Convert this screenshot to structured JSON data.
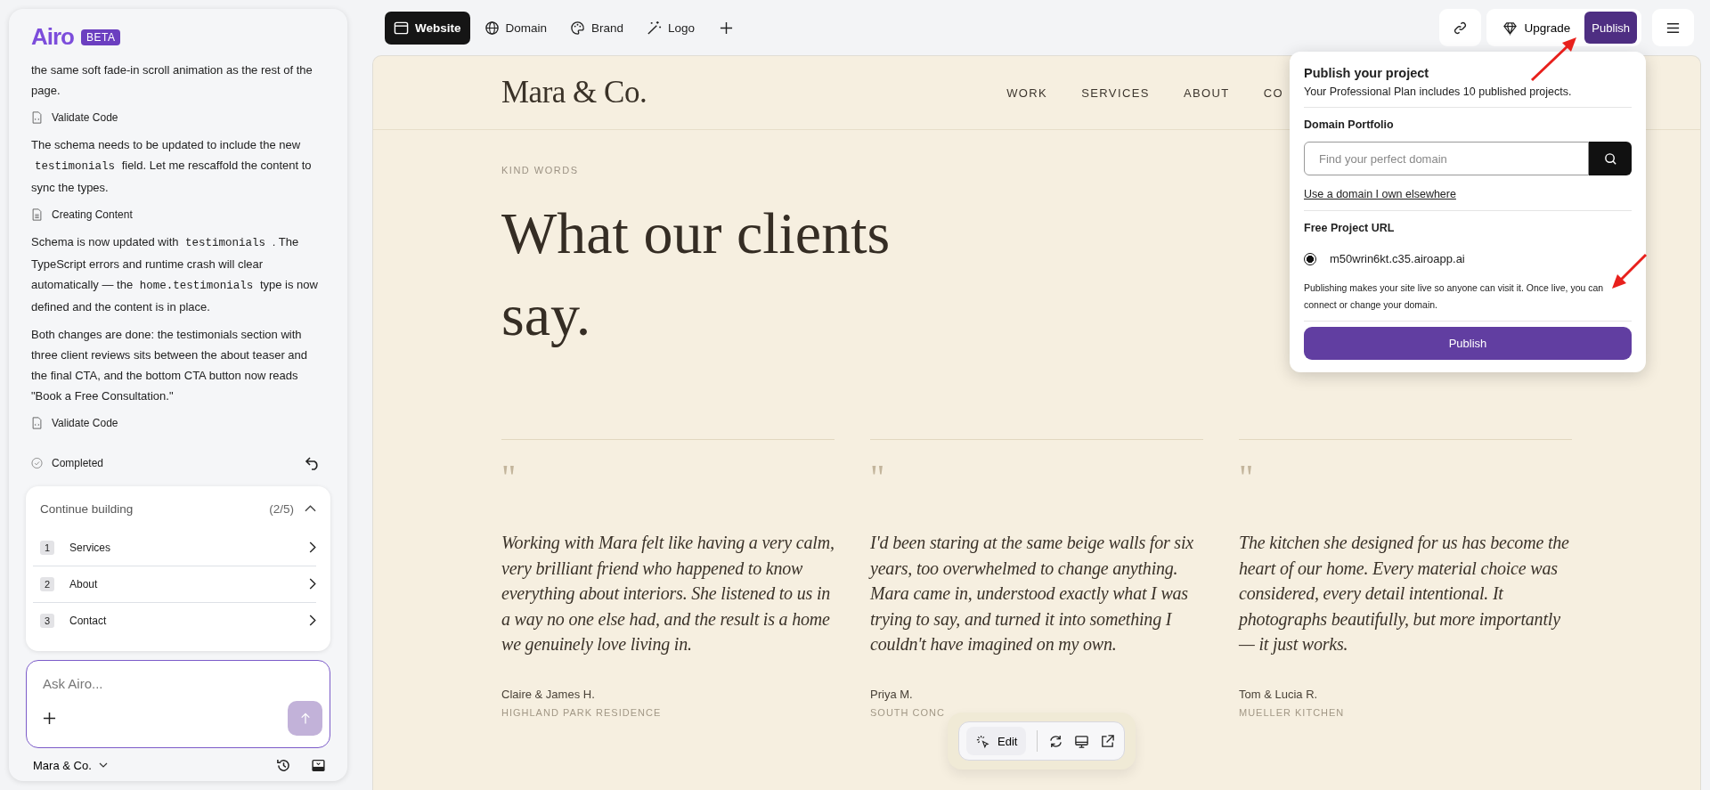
{
  "sidebar": {
    "logo": "Airo",
    "badge": "BETA",
    "chat": [
      {
        "kind": "text",
        "parts": [
          {
            "kind": "plain",
            "text": "the same soft fade-in scroll animation as the rest of the page."
          }
        ]
      },
      {
        "kind": "code-step",
        "label": "Validate Code"
      },
      {
        "kind": "text",
        "parts": [
          {
            "kind": "plain",
            "text": "The schema needs to be updated to include the new "
          },
          {
            "kind": "code",
            "text": "testimonials"
          },
          {
            "kind": "plain",
            "text": " field. Let me rescaffold the content to sync the types."
          }
        ]
      },
      {
        "kind": "content-step",
        "label": "Creating Content"
      },
      {
        "kind": "text",
        "parts": [
          {
            "kind": "plain",
            "text": "Schema is now updated with "
          },
          {
            "kind": "code",
            "text": "testimonials"
          },
          {
            "kind": "plain",
            "text": " . The TypeScript errors and runtime crash will clear automatically — the "
          },
          {
            "kind": "code",
            "text": "home.testimonials"
          },
          {
            "kind": "plain",
            "text": " type is now defined and the content is in place."
          }
        ]
      },
      {
        "kind": "text",
        "parts": [
          {
            "kind": "plain",
            "text": "Both changes are done: the testimonials section with three client reviews sits between the about teaser and the final CTA, and the bottom CTA button now reads \"Book a Free Consultation.\""
          }
        ]
      },
      {
        "kind": "code-step",
        "label": "Validate Code"
      }
    ],
    "status": "Completed",
    "continue_building": {
      "title": "Continue building",
      "count": "(2/5)",
      "expanded": true,
      "items": [
        {
          "number": "1",
          "label": "Services"
        },
        {
          "number": "2",
          "label": "About"
        },
        {
          "number": "3",
          "label": "Contact"
        }
      ]
    },
    "prompt": {
      "placeholder": "Ask Airo..."
    },
    "project": "Mara & Co."
  },
  "tabs": [
    {
      "label": "Website",
      "selected": true
    },
    {
      "label": "Domain",
      "selected": false
    },
    {
      "label": "Brand",
      "selected": false
    },
    {
      "label": "Logo",
      "selected": false
    }
  ],
  "top_actions": {
    "upgrade": "Upgrade",
    "publish": "Publish"
  },
  "site": {
    "logo": "Mara & Co.",
    "nav": [
      "WORK",
      "SERVICES",
      "ABOUT",
      "CO"
    ],
    "eyebrow": "KIND WORDS",
    "heading": "What our clients say.",
    "testimonials": [
      {
        "mark": "\"",
        "quote": "Working with Mara felt like having a very calm, very brilliant friend who happened to know everything about interiors. She listened to us in a way no one else had, and the result is a home we genuinely love living in.",
        "name": "Claire & James H.",
        "place": "HIGHLAND PARK RESIDENCE"
      },
      {
        "mark": "\"",
        "quote": "I'd been staring at the same beige walls for six years, too overwhelmed to change anything. Mara came in, understood exactly what I was trying to say, and turned it into something I couldn't have imagined on my own.",
        "name": "Priya M.",
        "place": "SOUTH CONC"
      },
      {
        "mark": "\"",
        "quote": "The kitchen she designed for us has become the heart of our home. Every material choice was considered, every detail intentional. It photographs beautifully, but more importantly — it just works.",
        "name": "Tom & Lucia R.",
        "place": "MUELLER KITCHEN"
      }
    ]
  },
  "edit_toolbar": {
    "edit": "Edit"
  },
  "publish_popup": {
    "title": "Publish your project",
    "subtitle": "Your Professional Plan includes 10 published projects.",
    "domain_label": "Domain Portfolio",
    "search": {
      "placeholder": "Find your perfect domain"
    },
    "link": "Use a domain I own elsewhere",
    "free_label": "Free Project URL",
    "url": {
      "text": "m50wrin6kt.c35.airoapp.ai",
      "selected": true
    },
    "note": "Publishing makes your site live so anyone can visit it. Once live, you can connect or change your domain.",
    "button": "Publish"
  }
}
